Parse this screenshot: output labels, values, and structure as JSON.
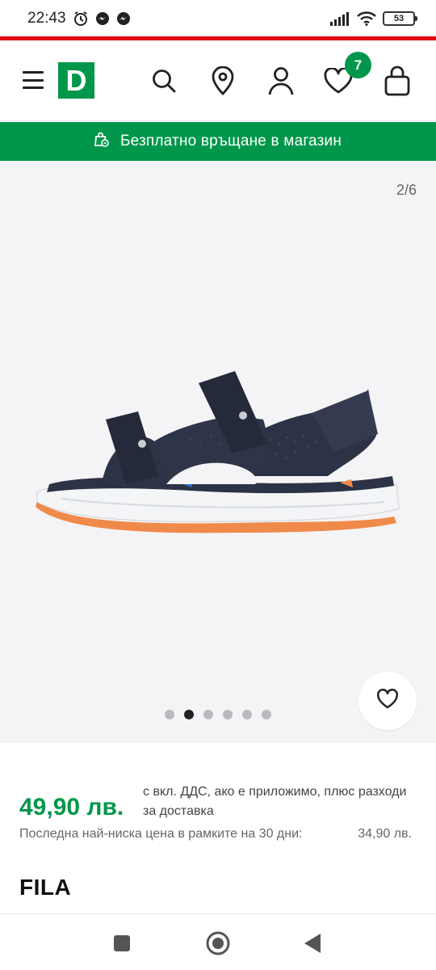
{
  "status_bar": {
    "time": "22:43",
    "battery": "53"
  },
  "header": {
    "logo_letter": "D",
    "wishlist_count": "7"
  },
  "promo": {
    "text": "Безплатно връщане в магазин"
  },
  "gallery": {
    "counter": "2/6",
    "total_dots": 6,
    "active_dot": 2
  },
  "product": {
    "price": "49,90 лв.",
    "vat_note": "с вкл. ДДС, ако е приложимо, плюс разходи за доставка",
    "lowest_price_label": "Последна най-ниска цена в рамките на 30 дни:",
    "lowest_price_value": "34,90 лв.",
    "brand": "FILA"
  },
  "colors": {
    "brand_green": "#00974a",
    "accent_red": "#e30613"
  },
  "icons": {
    "header": [
      "menu-icon",
      "search-icon",
      "location-pin-icon",
      "user-icon",
      "heart-icon",
      "shopping-bag-icon"
    ],
    "nav": [
      "recents-square-icon",
      "home-circle-icon",
      "back-triangle-icon"
    ]
  }
}
